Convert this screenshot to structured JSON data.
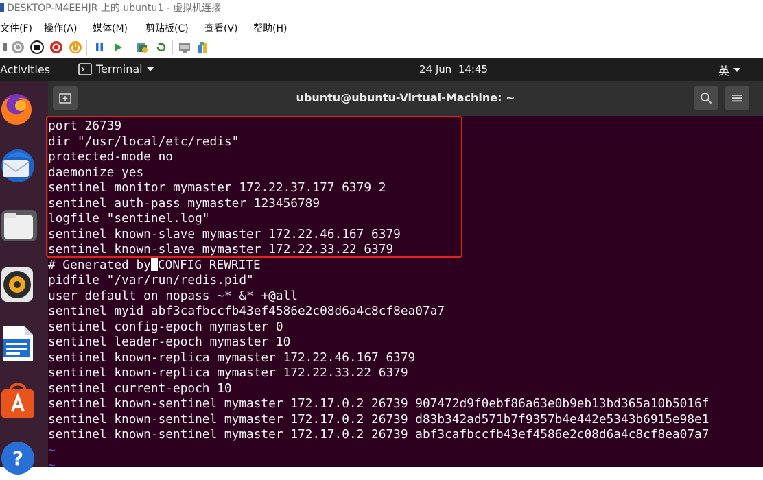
{
  "window": {
    "title": "DESKTOP-M4EEHJR 上的 ubuntu1 - 虚拟机连接"
  },
  "menu": [
    "文件(F)",
    "操作(A)",
    "媒体(M)",
    "剪贴板(C)",
    "查看(V)",
    "帮助(H)"
  ],
  "toolbar_icons": [
    "ctrl-alt-del-icon",
    "start-icon",
    "stop-icon",
    "shutdown-icon",
    "power-icon",
    "pause-icon",
    "play-icon",
    "checkpoint-icon",
    "revert-icon",
    "enhanced-session-icon",
    "share-icon"
  ],
  "gnome": {
    "activities": "Activities",
    "app": "Terminal",
    "clock": "24 Jun  14:45",
    "input_method": "英"
  },
  "dock": [
    "firefox-icon",
    "thunderbird-icon",
    "files-icon",
    "rhythmbox-icon",
    "writer-icon",
    "software-icon",
    "help-icon"
  ],
  "terminal": {
    "title": "ubuntu@ubuntu-Virtual-Machine: ~",
    "highlight_color": "#e3201b",
    "lines": [
      "port 26739",
      "dir \"/usr/local/etc/redis\"",
      "protected-mode no",
      "daemonize yes",
      "sentinel monitor mymaster 172.22.37.177 6379 2",
      "sentinel auth-pass mymaster 123456789",
      "logfile \"sentinel.log\"",
      "sentinel known-slave mymaster 172.22.46.167 6379",
      "sentinel known-slave mymaster 172.22.33.22 6379",
      "# Generated by",
      "CONFIG REWRITE",
      "pidfile \"/var/run/redis.pid\"",
      "user default on nopass ~* &* +@all",
      "sentinel myid abf3cafbccfb43ef4586e2c08d6a4c8cf8ea07a7",
      "sentinel config-epoch mymaster 0",
      "sentinel leader-epoch mymaster 10",
      "sentinel known-replica mymaster 172.22.46.167 6379",
      "sentinel known-replica mymaster 172.22.33.22 6379",
      "sentinel current-epoch 10",
      "sentinel known-sentinel mymaster 172.17.0.2 26739 907472d9f0ebf86a63e0b9eb13bd365a10b5016f",
      "sentinel known-sentinel mymaster 172.17.0.2 26739 d83b342ad571b7f9357b4e442e5343b6915e98e1",
      "sentinel known-sentinel mymaster 172.17.0.2 26739 abf3cafbccfb43ef4586e2c08d6a4c8cf8ea07a7",
      "~",
      "~"
    ]
  }
}
